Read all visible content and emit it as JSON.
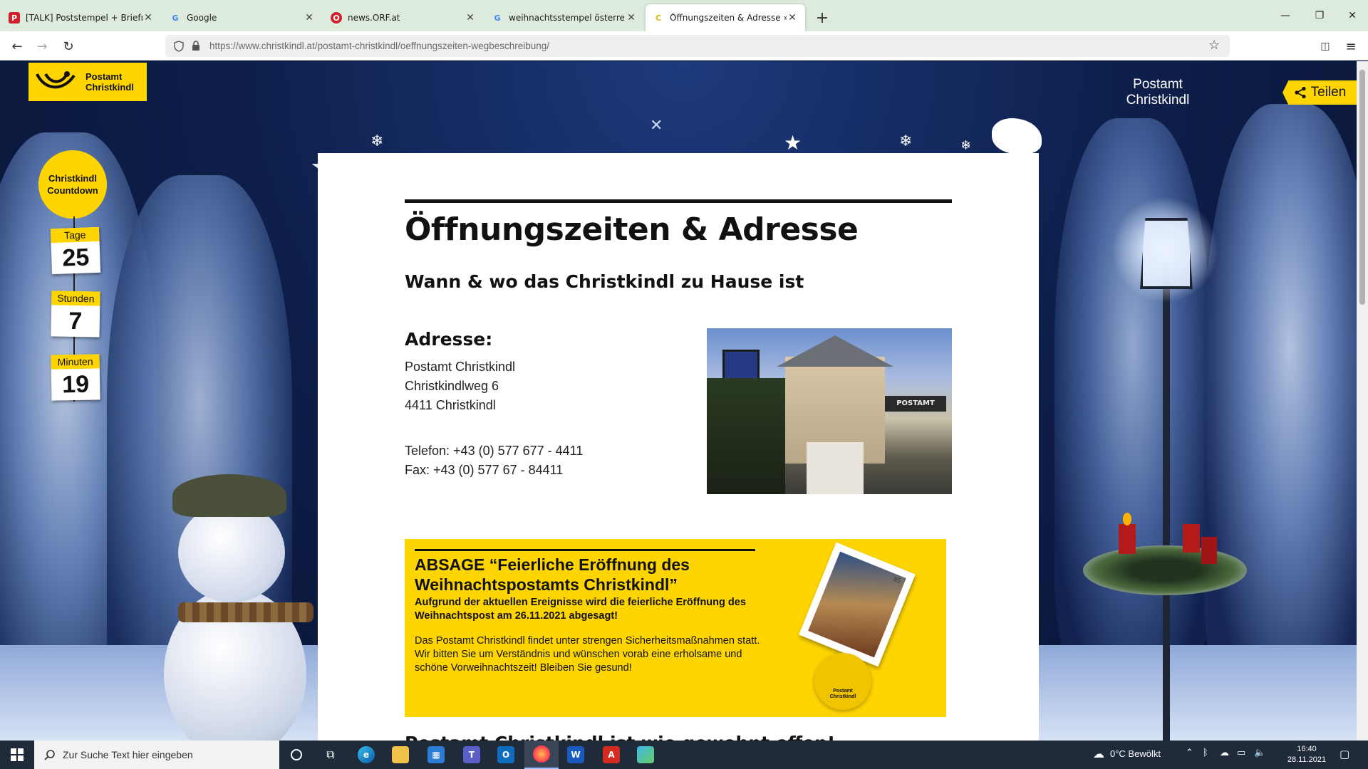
{
  "browser": {
    "tabs": [
      {
        "title": "[TALK] Poststempel + Briefmark",
        "favicon": "P",
        "favicon_color": "#d0202a",
        "active": false
      },
      {
        "title": "Google",
        "favicon": "G",
        "favicon_color": "#4285f4",
        "active": false
      },
      {
        "title": "news.ORF.at",
        "favicon": "O",
        "favicon_color": "#d0202a",
        "active": false
      },
      {
        "title": "weihnachtsstempel österreich p",
        "favicon": "G",
        "favicon_color": "#4285f4",
        "active": false
      },
      {
        "title": "Öffnungszeiten & Adresse » Da",
        "favicon": "C",
        "favicon_color": "#e0b400",
        "active": true
      }
    ],
    "new_tab_icon": "+",
    "url_host": "https://www.christkindl.at",
    "url_path": "/postamt-christkindl/oeffnungszeiten-wegbeschreibung/"
  },
  "site": {
    "logo_text": "Postamt\nChristkindl",
    "brand_right": "Postamt\nChristkindl",
    "share_label": "Teilen",
    "accent": "#ffd500"
  },
  "countdown": {
    "title": "Christkindl\nCountdown",
    "tage_label": "Tage",
    "tage_value": "25",
    "stunden_label": "Stunden",
    "stunden_value": "7",
    "minuten_label": "Minuten",
    "minuten_value": "19"
  },
  "content": {
    "title": "Öffnungszeiten & Adresse",
    "subtitle": "Wann & wo das Christkindl zu Hause ist",
    "address_heading": "Adresse:",
    "address_lines": [
      "Postamt Christkindl",
      "Christkindlweg 6",
      "4411 Christkindl"
    ],
    "phone": "Telefon: +43 (0) 577 677 - 4411",
    "fax": "Fax: +43 (0) 577 67 - 84411",
    "cut_heading": "Postamt Christkindl ist wie gewohnt offen!"
  },
  "notice": {
    "title": "ABSAGE “Feierliche Eröffnung des Weihnachtspostamts Christkindl”",
    "bold": "Aufgrund der aktuellen Ereignisse wird die feierliche Eröffnung des Weihnachtspost am 26.11.2021 abgesagt!",
    "body": "Das Postamt Christkindl findet unter strengen Sicherheitsmaßnahmen statt. Wir bitten Sie um Verständnis und wünschen vorab eine erholsame und schöne Vorweihnachtszeit! Bleiben Sie gesund!",
    "stamp_value": "85",
    "seal_text": "Postamt\nChristkindl"
  },
  "taskbar": {
    "search_placeholder": "Zur Suche Text hier eingeben",
    "weather": "0°C  Bewölkt",
    "time": "16:40",
    "date": "28.11.2021"
  }
}
